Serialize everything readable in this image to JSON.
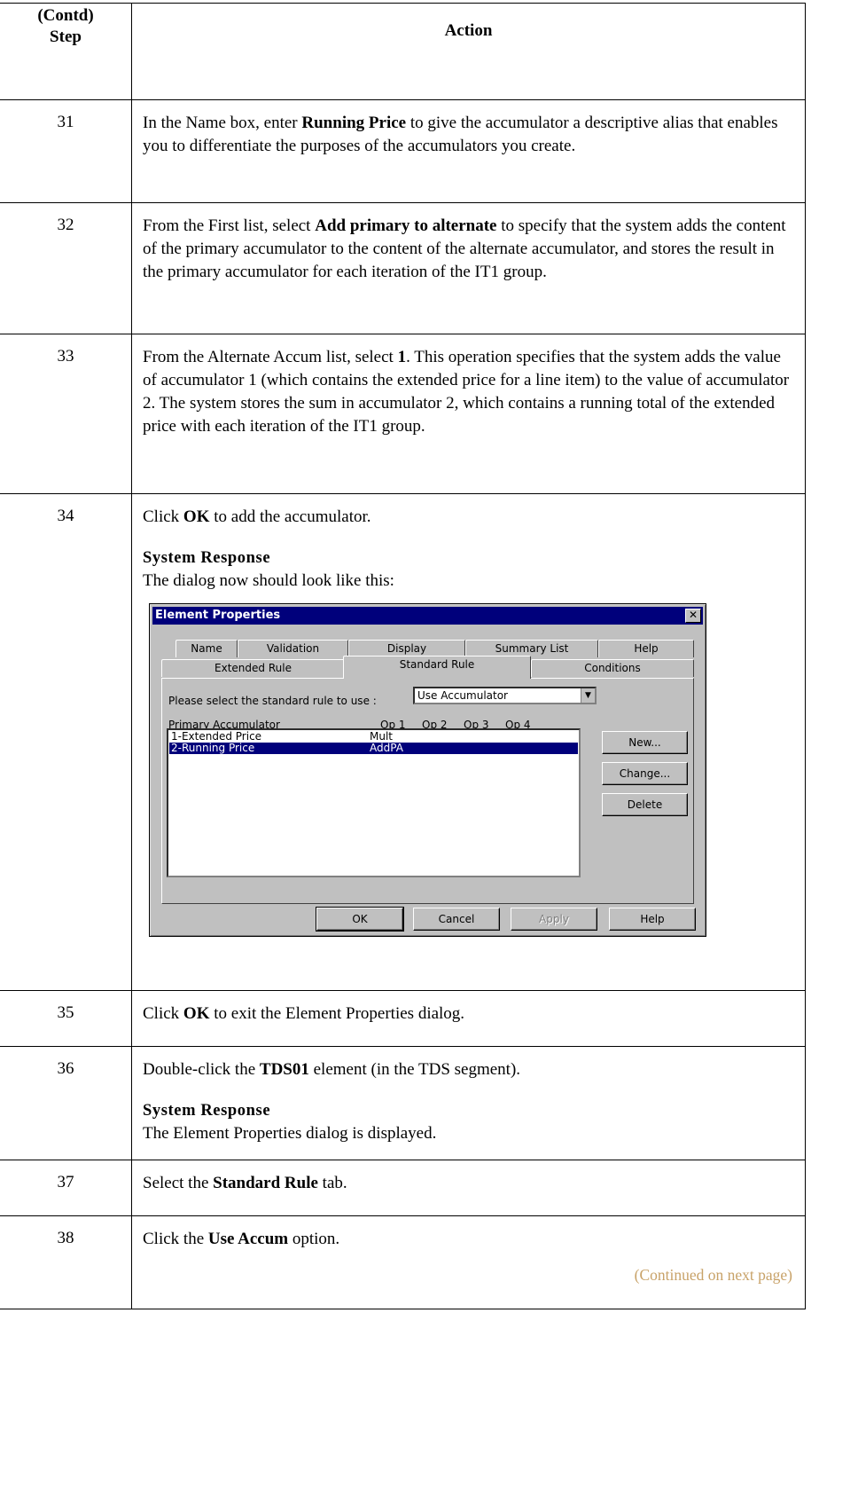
{
  "header": {
    "step_line1": "(Contd)",
    "step_line2": "Step",
    "action": "Action"
  },
  "rows": [
    {
      "step": "31",
      "segments": [
        "In the Name box, enter ",
        "Running Price",
        " to give the accumulator a descriptive alias that enables you to differentiate the purposes of the accumulators you create."
      ]
    },
    {
      "step": "32",
      "segments": [
        "From the First list, select ",
        "Add primary to alternate",
        " to specify that the system adds the content of the primary accumulator to the content of the alternate accumulator, and stores the result in the primary accumulator for each iteration of the IT1 group."
      ]
    },
    {
      "step": "33",
      "segments": [
        "From the Alternate Accum list, select ",
        "1",
        ". This operation specifies that the system adds the value of accumulator 1 (which contains the extended price for a line item) to the value of accumulator 2. The system stores the sum in accumulator 2, which contains a running total of the extended price with each iteration of the IT1 group."
      ]
    },
    {
      "step": "34",
      "segments": [
        "Click ",
        "OK",
        " to add the accumulator."
      ],
      "response_title": "System Response",
      "response_text": "The dialog now should look like this:"
    },
    {
      "step": "35",
      "segments": [
        "Click ",
        "OK",
        " to exit the Element Properties dialog."
      ]
    },
    {
      "step": "36",
      "segments": [
        "Double-click the ",
        "TDS01",
        " element (in the TDS segment)."
      ],
      "response_title": "System Response",
      "response_text": "The Element Properties dialog is displayed."
    },
    {
      "step": "37",
      "segments": [
        "Select the ",
        "Standard Rule",
        " tab."
      ]
    },
    {
      "step": "38",
      "segments": [
        "Click the ",
        "Use Accum",
        " option."
      ],
      "continued": "(Continued on next page)"
    }
  ],
  "dialog": {
    "title": "Element Properties",
    "tabs_back": [
      "Name",
      "Validation",
      "Display",
      "Summary List",
      "Help"
    ],
    "tabs_front": [
      "Extended Rule",
      "Standard Rule",
      "Conditions"
    ],
    "active_tab": "Standard Rule",
    "rule_label": "Please select the standard rule to use :",
    "rule_value": "Use Accumulator",
    "columns": [
      "Primary Accumulator",
      "Op 1",
      "Op 2",
      "Op 3",
      "Op 4"
    ],
    "list": [
      {
        "name": "1-Extended Price",
        "op": "Mult",
        "selected": false
      },
      {
        "name": "2-Running Price",
        "op": "AddPA",
        "selected": true
      }
    ],
    "side_buttons": [
      "New...",
      "Change...",
      "Delete"
    ],
    "bottom_buttons": [
      "OK",
      "Cancel",
      "Apply",
      "Help"
    ]
  },
  "colors": {
    "titlebar": "#00007b",
    "dialog_face": "#c0c0c0",
    "continued_text": "#c8a268"
  }
}
